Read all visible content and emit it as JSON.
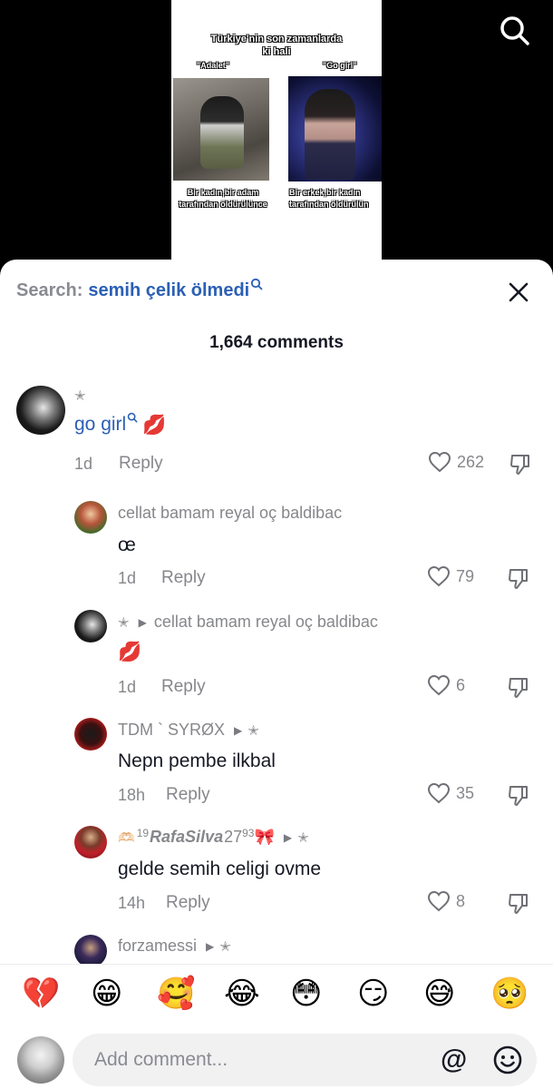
{
  "video": {
    "title_line1": "Türkiye'nin son zamanlarda",
    "title_line2": "ki hali",
    "left_label": "\"Adalet\"",
    "right_label": "\"Go girl\"",
    "left_caption_1": "Bir kadın,bir adam",
    "left_caption_2": "tarafından öldürülünce",
    "right_caption_1": "Bir erkek,bir kadın",
    "right_caption_2": "tarafından öldürülün"
  },
  "sheet": {
    "search_prefix": "Search:",
    "search_query": "semih çelik ölmedi",
    "comment_count": "1,664 comments"
  },
  "comments": [
    {
      "name": "",
      "text": "go girl",
      "emoji": "💋",
      "time": "1d",
      "reply": "Reply",
      "likes": "262"
    },
    {
      "name": "cellat bamam reyal oç baldibac",
      "text": "œ",
      "time": "1d",
      "reply": "Reply",
      "likes": "79"
    },
    {
      "reply_to": "cellat bamam reyal oç baldibac",
      "text": "💋",
      "time": "1d",
      "reply": "Reply",
      "likes": "6"
    },
    {
      "name": "TDM ` SYRØX",
      "text": "Nepn pembe ilkbal",
      "time": "18h",
      "reply": "Reply",
      "likes": "35"
    },
    {
      "name_prefix": "🫶🏻",
      "name_sup1": "19",
      "name_main": "RafaSilva",
      "name_num": "27",
      "name_sup2": "93",
      "name_suffix": "🎀",
      "text": "gelde semih celigi ovme",
      "time": "14h",
      "reply": "Reply",
      "likes": "8"
    },
    {
      "name": "forzamessi"
    }
  ],
  "emojis": [
    "💔",
    "😁",
    "🥰",
    "😂",
    "😳",
    "😏",
    "😅",
    "🥺"
  ],
  "input": {
    "placeholder": "Add comment...",
    "at": "@"
  },
  "colors": {
    "link_blue": "#2b5fb5",
    "muted": "#86878b",
    "text": "#161823"
  },
  "icons": [
    "search-icon",
    "close-icon",
    "heart-icon",
    "dislike-icon",
    "smile-icon",
    "star-icon",
    "caret-right-icon"
  ]
}
